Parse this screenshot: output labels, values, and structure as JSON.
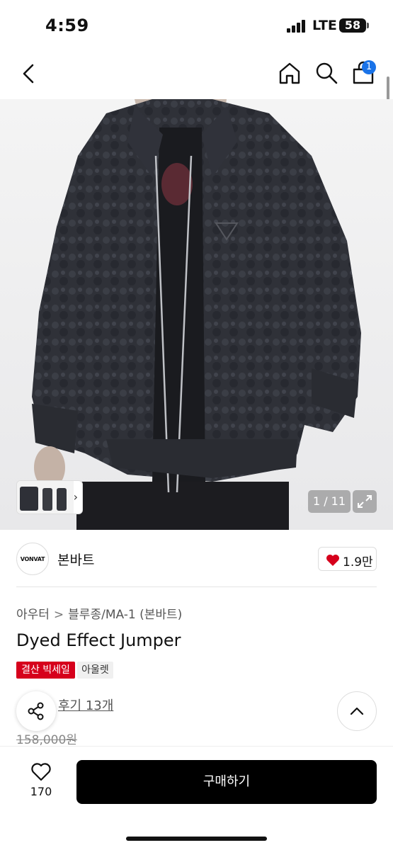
{
  "status_bar": {
    "time": "4:59",
    "network": "LTE",
    "battery": "58"
  },
  "nav": {
    "cart_count": "1"
  },
  "gallery": {
    "counter": "1 / 11"
  },
  "brand": {
    "logo_text": "VONVAT",
    "name": "본바트",
    "likes": "1.9만"
  },
  "breadcrumb": {
    "category": "아우터",
    "subcategory": "블루종/MA-1 (본바트)"
  },
  "product": {
    "title": "Dyed Effect Jumper",
    "tags": [
      "결산 빅세일",
      "아울렛"
    ],
    "review": "후기 13개",
    "original_price": "158,000원"
  },
  "bottom_bar": {
    "like_count": "170",
    "buy_label": "구매하기"
  },
  "colors": {
    "accent": "#d6001c",
    "badge": "#1a73e8",
    "buy": "#000000"
  }
}
